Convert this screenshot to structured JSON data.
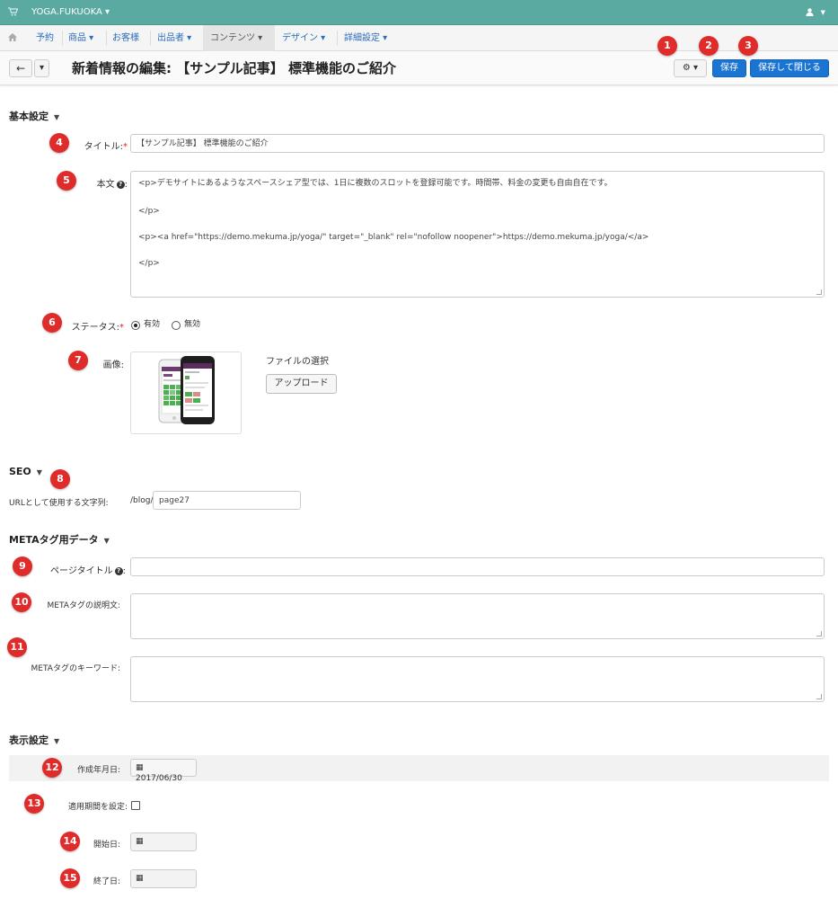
{
  "topbar": {
    "cart_icon": "cart-icon",
    "site_name": "YOGA.FUKUOKA ▾",
    "user_menu": "👤 ▾"
  },
  "nav": {
    "home_icon": "home-icon",
    "items": [
      "予約",
      "商品 ▾",
      "お客様",
      "出品者 ▾",
      "コンテンツ ▾",
      "デザイン ▾",
      "詳細設定 ▾"
    ]
  },
  "header": {
    "back_label": "←",
    "back_dropdown": "▾",
    "title": "新着情報の編集: 【サンプル記事】 標準機能のご紹介",
    "gear_label": "⚙ ▾",
    "save_label": "保存",
    "save_close_label": "保存して閉じる"
  },
  "badges": [
    "1",
    "2",
    "3",
    "4",
    "5",
    "6",
    "7",
    "8",
    "9",
    "10",
    "11",
    "12",
    "13",
    "14",
    "15"
  ],
  "basic": {
    "section_title": "基本設定",
    "title_label": "タイトル:",
    "title_value": "【サンプル記事】 標準機能のご紹介",
    "body_label": "本文",
    "body_lines": [
      "<p>デモサイトにあるようなスペースシェア型では、1日に複数のスロットを登録可能です。時間帯、料金の変更も自由自在です。",
      "</p>",
      "<p><a href=\"https://demo.mekuma.jp/yoga/\" target=\"_blank\" rel=\"nofollow noopener\">https://demo.mekuma.jp/yoga/</a>",
      "</p>"
    ],
    "status_label": "ステータス:",
    "status_options": [
      "有効",
      "無効"
    ],
    "status_selected": "有効",
    "image_label": "画像:",
    "file_select_label": "ファイルの選択",
    "upload_label": "アップロード"
  },
  "seo": {
    "section_title": "SEO",
    "url_label": "URLとして使用する文字列:",
    "url_prefix": "/blog/",
    "url_value": "page27"
  },
  "meta": {
    "section_title": "METAタグ用データ",
    "page_title_label": "ページタイトル",
    "page_title_value": "",
    "description_label": "METAタグの説明文:",
    "keywords_label": "METAタグのキーワード:"
  },
  "display": {
    "section_title": "表示設定",
    "created_label": "作成年月日:",
    "created_value": "2017/06/30",
    "period_label": "適用期間を設定:",
    "start_label": "開始日:",
    "end_label": "終了日:"
  }
}
